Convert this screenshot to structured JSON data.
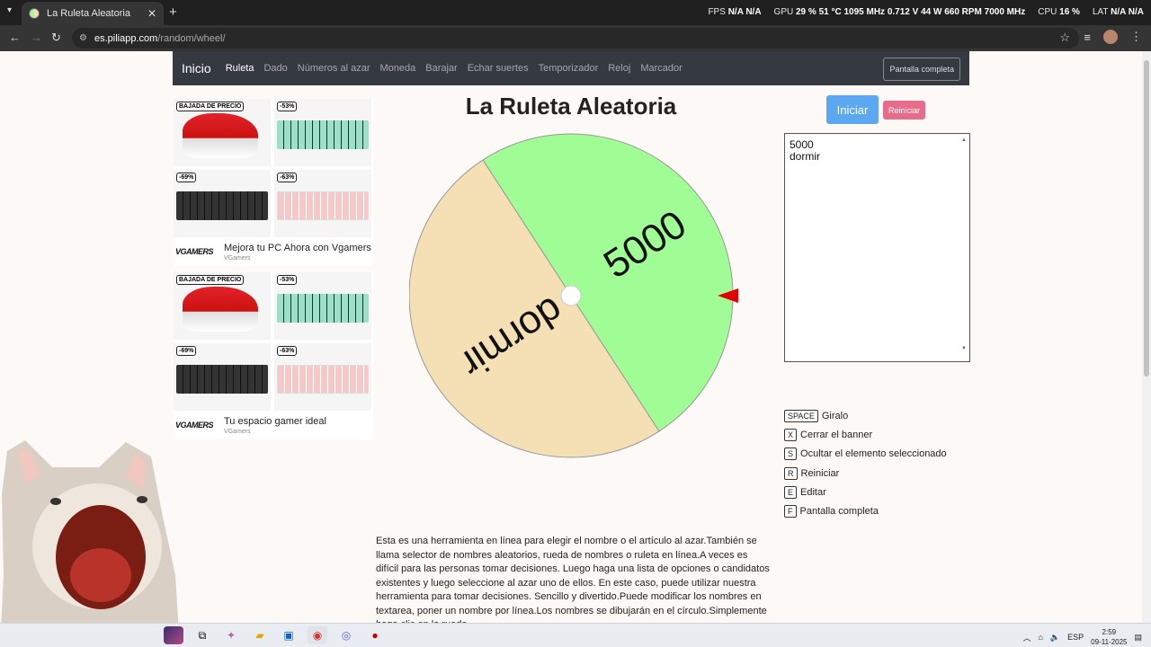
{
  "browser": {
    "tab_title": "La Ruleta Aleatoria",
    "url_host": "es.piliapp.com",
    "url_path": "/random/wheel/"
  },
  "overlay_stats": {
    "fps_label": "FPS",
    "fps_value": "N/A N/A",
    "gpu_label": "GPU",
    "gpu_value": "29 % 51 °C 1095 MHz 0.712 V 44 W 660 RPM 7000 MHz",
    "cpu_label": "CPU",
    "cpu_value": "16 %",
    "lat_label": "LAT",
    "lat_value": "N/A N/A"
  },
  "site_nav": {
    "brand": "Inicio",
    "links": [
      "Ruleta",
      "Dado",
      "Números al azar",
      "Moneda",
      "Barajar",
      "Echar suertes",
      "Temporizador",
      "Reloj",
      "Marcador"
    ],
    "fullscreen": "Pantalla completa"
  },
  "ads": [
    {
      "badges": [
        "BAJADA DE PRECIO",
        "-53%",
        "-69%",
        "-63%"
      ],
      "logo": "VGAMERS",
      "headline": "Mejora tu PC Ahora con Vgamers",
      "advertiser": "VGamers"
    },
    {
      "badges": [
        "BAJADA DE PRECIO",
        "-53%",
        "-69%",
        "-63%"
      ],
      "logo": "VGAMERS",
      "headline": "Tu espacio gamer ideal",
      "advertiser": "VGamers"
    }
  ],
  "wheel": {
    "title": "La Ruleta Aleatoria",
    "segments": [
      {
        "label": "5000",
        "color": "#a0fc94"
      },
      {
        "label": "dormir",
        "color": "#f5dfb4"
      }
    ],
    "pointer_color": "#e00000"
  },
  "controls": {
    "start": "Iniciar",
    "reset": "Reiniciar"
  },
  "names_text": "5000\ndormir",
  "shortcuts": [
    {
      "key": "SPACE",
      "label": "Giralo"
    },
    {
      "key": "X",
      "label": "Cerrar el banner"
    },
    {
      "key": "S",
      "label": "Ocultar el elemento seleccionado"
    },
    {
      "key": "R",
      "label": "Reiniciar"
    },
    {
      "key": "E",
      "label": "Editar"
    },
    {
      "key": "F",
      "label": "Pantalla completa"
    }
  ],
  "description": "Esta es una herramienta en línea para elegir el nombre o el artículo al azar.También se llama selector de nombres aleatorios, rueda de nombres o ruleta en línea.A veces es difícil para las personas tomar decisiones. Luego haga una lista de opciones o candidatos existentes y luego seleccione al azar uno de ellos. En este caso, puede utilizar nuestra herramienta para tomar decisiones. Sencillo y divertido.Puede modificar los nombres en textarea, poner un nombre por línea.Los nombres se dibujarán en el círculo.Simplemente haga clic en la rueda",
  "taskbar": {
    "lang": "ESP",
    "time": "2:59",
    "date": "09-11-2025"
  }
}
